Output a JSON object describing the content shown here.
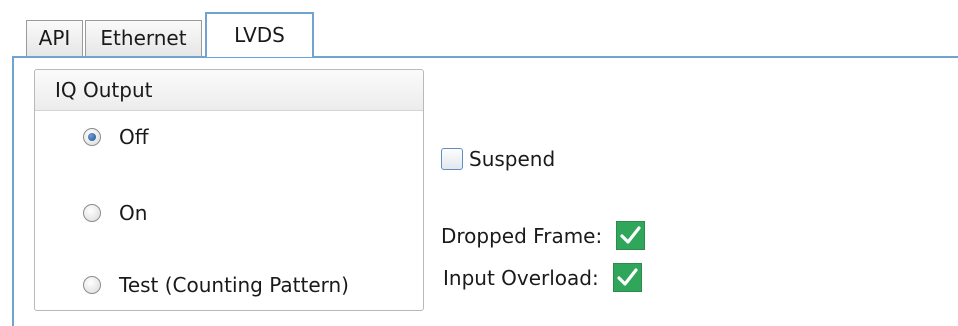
{
  "tabs": [
    {
      "label": "API"
    },
    {
      "label": "Ethernet"
    },
    {
      "label": "LVDS"
    }
  ],
  "iq_output": {
    "title": "IQ Output",
    "options": [
      {
        "label": "Off",
        "checked": true
      },
      {
        "label": "On",
        "checked": false
      },
      {
        "label": "Test (Counting Pattern)",
        "checked": false
      }
    ]
  },
  "suspend": {
    "label": "Suspend",
    "checked": false
  },
  "status": {
    "dropped_frame_label": "Dropped Frame:",
    "input_overload_label": "Input Overload:"
  },
  "colors": {
    "accent": "#6fa3d2",
    "indicator_green": "#2fa65a"
  }
}
